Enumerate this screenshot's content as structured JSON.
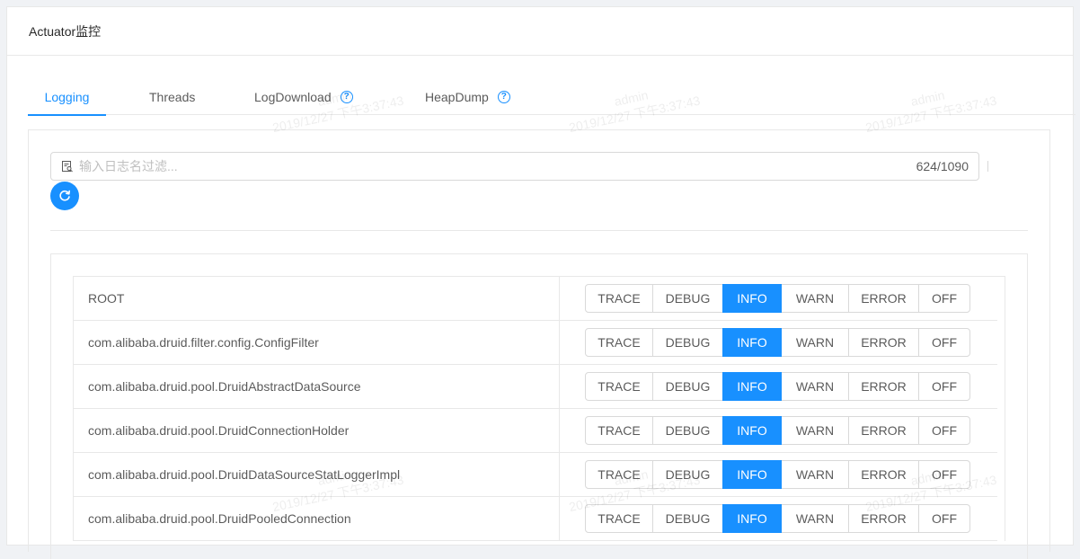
{
  "header": {
    "title": "Actuator监控"
  },
  "tabs": [
    {
      "label": "Logging"
    },
    {
      "label": "Threads"
    },
    {
      "label": "LogDownload"
    },
    {
      "label": "HeapDump"
    }
  ],
  "search": {
    "placeholder": "输入日志名过滤...",
    "count": "624/1090"
  },
  "levels": [
    "TRACE",
    "DEBUG",
    "INFO",
    "WARN",
    "ERROR",
    "OFF"
  ],
  "rows": [
    {
      "name": "ROOT",
      "selected": "INFO"
    },
    {
      "name": "com.alibaba.druid.filter.config.ConfigFilter",
      "selected": "INFO"
    },
    {
      "name": "com.alibaba.druid.pool.DruidAbstractDataSource",
      "selected": "INFO"
    },
    {
      "name": "com.alibaba.druid.pool.DruidConnectionHolder",
      "selected": "INFO"
    },
    {
      "name": "com.alibaba.druid.pool.DruidDataSourceStatLoggerImpl",
      "selected": "INFO"
    },
    {
      "name": "com.alibaba.druid.pool.DruidPooledConnection",
      "selected": "INFO"
    }
  ],
  "watermark": {
    "user": "admin",
    "time": "2019/12/27 下午3:37:43"
  },
  "colors": {
    "accent": "#1890ff",
    "border": "#e8e8e8"
  }
}
